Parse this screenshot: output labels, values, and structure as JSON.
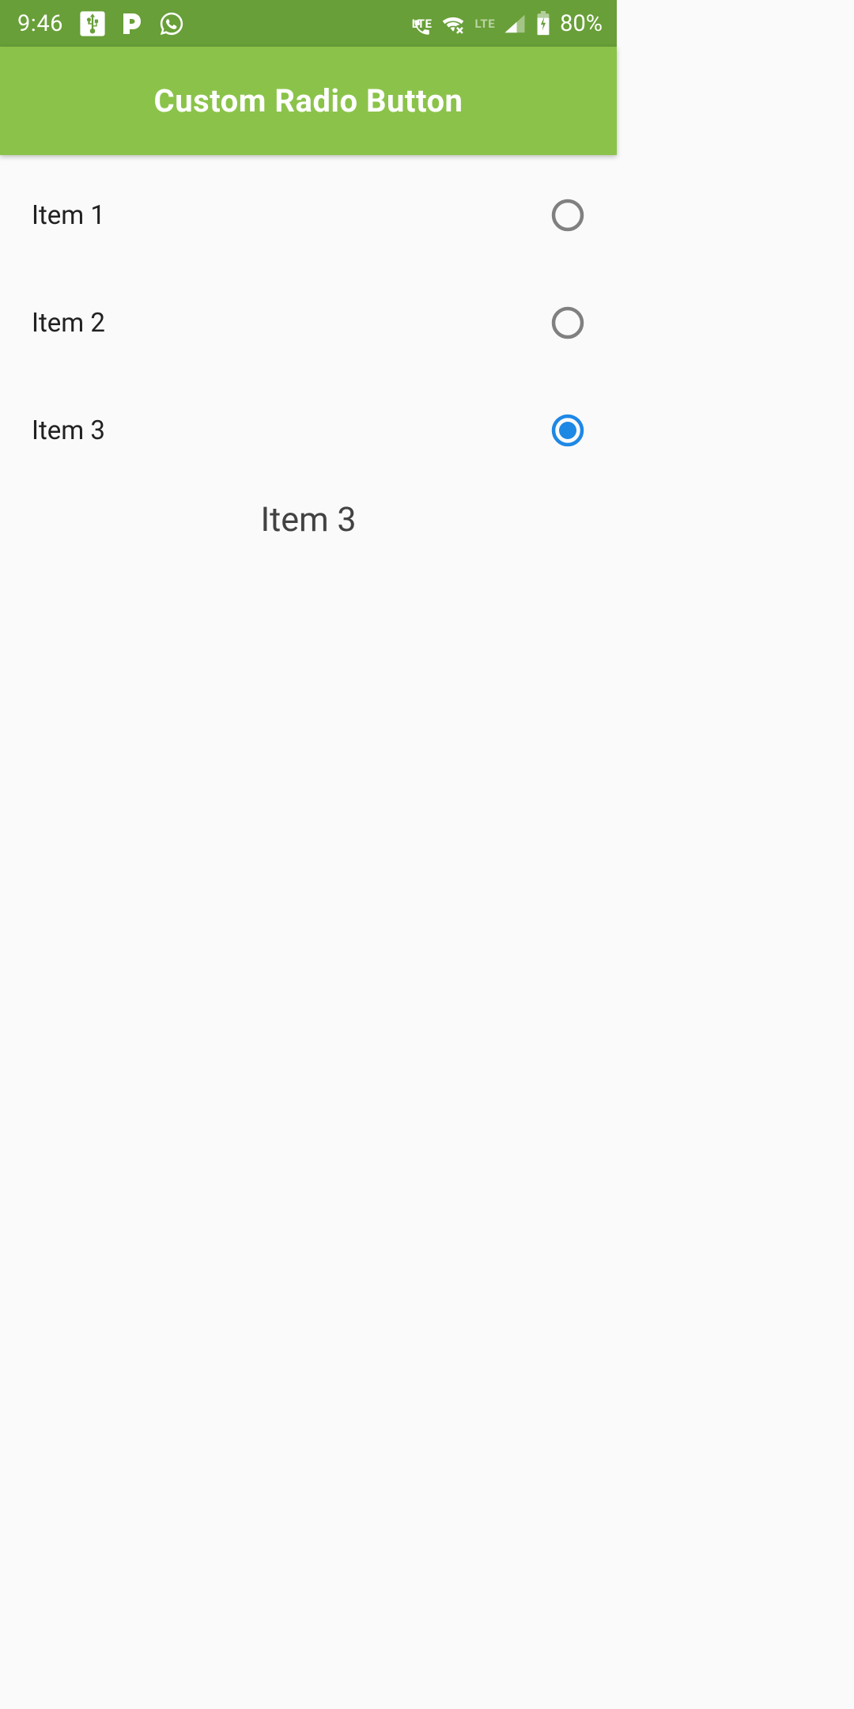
{
  "status": {
    "time": "9:46",
    "battery": "80%",
    "lte1": "LTE",
    "lte2": "LTE",
    "icons": {
      "usb": "usb-icon",
      "p": "p-icon",
      "whatsapp": "whatsapp-icon",
      "wifi_call": "wifi-call-icon",
      "wifi_off": "wifi-off-icon",
      "signal": "signal-icon",
      "battery": "battery-charging-icon"
    }
  },
  "header": {
    "title": "Custom Radio Button"
  },
  "radio": {
    "items": [
      {
        "label": "Item 1",
        "selected": false
      },
      {
        "label": "Item 2",
        "selected": false
      },
      {
        "label": "Item 3",
        "selected": true
      }
    ],
    "selected_label": "Item 3"
  },
  "colors": {
    "status_bar": "#689f38",
    "app_bar": "#8bc34a",
    "radio_unselected": "#808080",
    "radio_selected": "#1e88e5"
  }
}
